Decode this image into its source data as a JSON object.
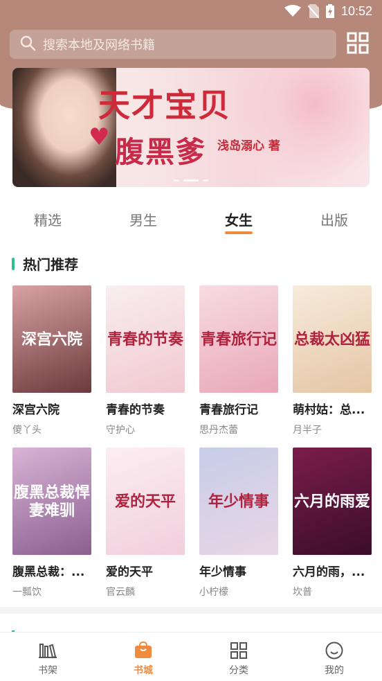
{
  "status_bar": {
    "time": "10:52"
  },
  "search": {
    "placeholder": "搜索本地及网络书籍"
  },
  "banner": {
    "title_line1": "天才宝贝",
    "title_line2": "腹黑爹",
    "author": "浅岛溺心 著"
  },
  "tabs": [
    {
      "label": "精选"
    },
    {
      "label": "男生"
    },
    {
      "label": "女生"
    },
    {
      "label": "出版"
    }
  ],
  "active_tab": "女生",
  "section": {
    "title": "热门推荐"
  },
  "books": [
    {
      "title": "深宫六院",
      "author": "傻丫头",
      "cover_text": "深宫六院",
      "cover_colors": [
        "#d9a2a4",
        "#6b3a3c"
      ]
    },
    {
      "title": "青春的节奏",
      "author": "守护心",
      "cover_text": "青春的节奏",
      "cover_colors": [
        "#f8eef0",
        "#f1c9d0"
      ]
    },
    {
      "title": "青春旅行记",
      "author": "思丹杰蕾",
      "cover_text": "青春旅行记",
      "cover_colors": [
        "#f7dce3",
        "#e9a7b8"
      ]
    },
    {
      "title": "萌村姑：总...",
      "author": "月半子",
      "cover_text": "总裁太凶猛",
      "cover_colors": [
        "#f7ebdc",
        "#e4c6a4"
      ]
    },
    {
      "title": "腹黑总裁：...",
      "author": "一瓢饮",
      "cover_text": "腹黑总裁悍妻难驯",
      "cover_colors": [
        "#d8b4d6",
        "#8b5f8f"
      ]
    },
    {
      "title": "爱的天平",
      "author": "官云麟",
      "cover_text": "爱的天平",
      "cover_colors": [
        "#fbeef2",
        "#f1cfdc"
      ]
    },
    {
      "title": "年少情事",
      "author": "小柠檬",
      "cover_text": "年少情事",
      "cover_colors": [
        "#c7cde8",
        "#e9d6e6"
      ]
    },
    {
      "title": "六月的雨，...",
      "author": "坎普",
      "cover_text": "六月的雨爱",
      "cover_colors": [
        "#7a1d4a",
        "#3b0d2a"
      ]
    }
  ],
  "bottom_nav": [
    {
      "label": "书架",
      "icon": "bookshelf-icon"
    },
    {
      "label": "书城",
      "icon": "bookstore-icon"
    },
    {
      "label": "分类",
      "icon": "category-icon"
    },
    {
      "label": "我的",
      "icon": "profile-icon"
    }
  ],
  "colors": {
    "accent": "#f08a3e",
    "header": "#b5887a",
    "section_bar": "#2cbf8f"
  }
}
